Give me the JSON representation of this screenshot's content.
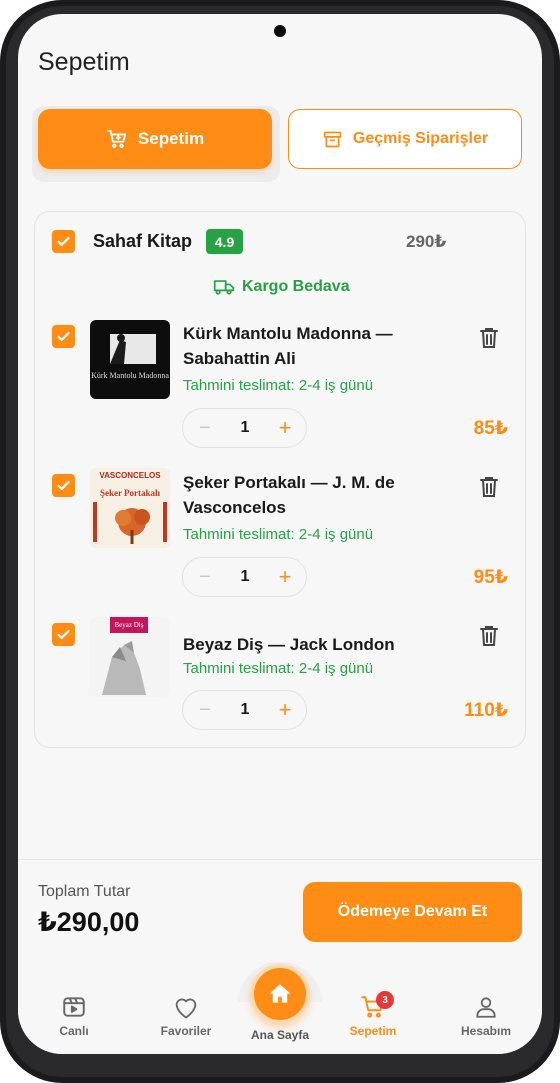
{
  "screen": {
    "title": "Sepetim"
  },
  "tabs": {
    "cart_label": "Sepetim",
    "orders_label": "Geçmiş Siparişler"
  },
  "seller": {
    "name": "Sahaf Kitap",
    "rating": "4.9",
    "total": "290₺",
    "shipping_label": "Kargo Bedava"
  },
  "items": [
    {
      "title": "Kürk Mantolu Madonna — Sabahattin Ali",
      "delivery": "Tahmini teslimat: 2-4 iş günü",
      "quantity": "1",
      "price": "85₺",
      "cover": {
        "text": "Kürk Mantolu Madonna",
        "bg": "#0d0d0d"
      }
    },
    {
      "title": "Şeker Portakalı — J. M. de Vasconcelos",
      "delivery": "Tahmini teslimat: 2-4 iş günü",
      "quantity": "1",
      "price": "95₺",
      "cover": {
        "top_text": "VASCONCELOS",
        "title_text": "Şeker Portakalı",
        "bg": "#f6efe4"
      }
    },
    {
      "title": "Beyaz Diş — Jack London",
      "delivery": "Tahmini teslimat: 2-4 iş günü",
      "quantity": "1",
      "price": "110₺",
      "cover": {
        "top_text": "Beyaz Diş",
        "bg": "#f4f4f4"
      }
    }
  ],
  "summary": {
    "total_label": "Toplam Tutar",
    "total_value": "₺290,00",
    "checkout_label": "Ödemeye Devam Et"
  },
  "nav": {
    "items": [
      {
        "label": "Canlı",
        "icon": "video-icon"
      },
      {
        "label": "Favoriler",
        "icon": "heart-icon"
      },
      {
        "label": "Ana Sayfa",
        "icon": "home-icon"
      },
      {
        "label": "Sepetim",
        "icon": "cart-icon",
        "badge": "3"
      },
      {
        "label": "Hesabım",
        "icon": "user-icon"
      }
    ]
  },
  "colors": {
    "accent": "#ff8c14",
    "success": "#26a244",
    "badge": "#e53935"
  }
}
